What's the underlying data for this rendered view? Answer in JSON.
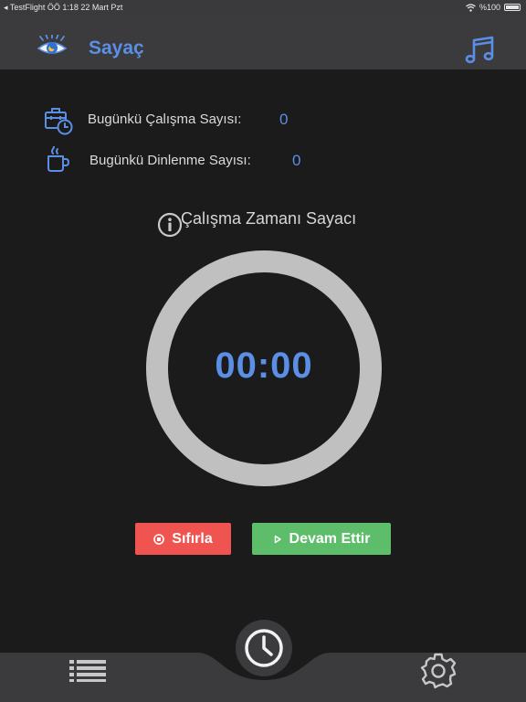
{
  "status_bar": {
    "left_text": "◂ TestFlight   ÖÖ 1:18   22 Mart Pzt",
    "battery_text": "%100",
    "icons": [
      "wifi-icon",
      "battery-icon"
    ]
  },
  "header": {
    "title": "Sayaç",
    "icons": [
      "eye-icon",
      "music-note-icon"
    ]
  },
  "stats": {
    "work_label": "Bugünkü Çalışma Sayısı:",
    "work_value": "0",
    "rest_label": "Bugünkü Dinlenme Sayısı:",
    "rest_value": "0",
    "icons": [
      "briefcase-clock-icon",
      "coffee-cup-icon"
    ]
  },
  "timer": {
    "title": "Çalışma Zamanı Sayacı",
    "display": "00:00",
    "icons": [
      "info-icon"
    ]
  },
  "controls": {
    "reset_label": "Sıfırla",
    "resume_label": "Devam Ettir",
    "icons": [
      "stop-circle-icon",
      "play-icon"
    ]
  },
  "tab_bar": {
    "icons": [
      "list-icon",
      "clock-icon",
      "gear-icon"
    ]
  },
  "colors": {
    "background": "#1b1b1c",
    "bar": "#3b3b3d",
    "accent": "#5b8fe6",
    "ring": "#c0c0c0",
    "reset": "#ef5451",
    "resume": "#5dbd6a"
  }
}
